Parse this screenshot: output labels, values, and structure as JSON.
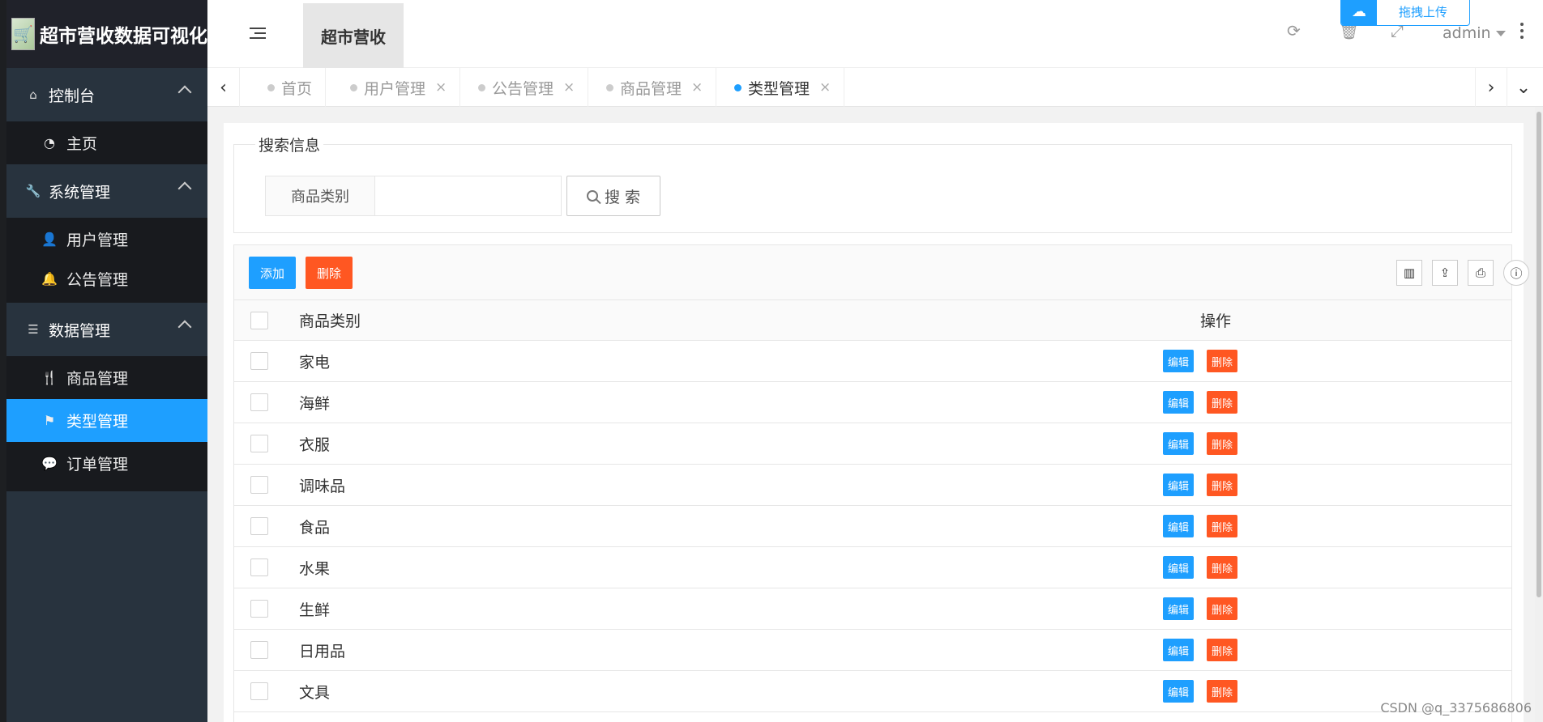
{
  "sidebar": {
    "logo_text": "超市营收数据可视化",
    "groups": [
      {
        "label": "控制台",
        "icon": "home-icon",
        "items": [
          {
            "label": "主页",
            "icon": "dashboard-icon"
          }
        ]
      },
      {
        "label": "系统管理",
        "icon": "wrench-icon",
        "items": [
          {
            "label": "用户管理",
            "icon": "user-icon"
          },
          {
            "label": "公告管理",
            "icon": "bell-icon"
          }
        ]
      },
      {
        "label": "数据管理",
        "icon": "server-icon",
        "items": [
          {
            "label": "商品管理",
            "icon": "cutlery-icon"
          },
          {
            "label": "类型管理",
            "icon": "flag-icon"
          },
          {
            "label": "订单管理",
            "icon": "chat-icon"
          }
        ]
      }
    ]
  },
  "header": {
    "title": "超市营收",
    "upload_label": "拖拽上传",
    "user": "admin"
  },
  "tabs": [
    {
      "label": "首页"
    },
    {
      "label": "用户管理"
    },
    {
      "label": "公告管理"
    },
    {
      "label": "商品管理"
    },
    {
      "label": "类型管理"
    }
  ],
  "search": {
    "legend": "搜索信息",
    "field_label": "商品类别",
    "button_label": "搜 索"
  },
  "toolbar": {
    "add_label": "添加",
    "delete_label": "删除"
  },
  "table": {
    "columns": [
      "商品类别",
      "操作"
    ],
    "edit_label": "编辑",
    "delete_label": "删除",
    "rows": [
      "家电",
      "海鲜",
      "衣服",
      "调味品",
      "食品",
      "水果",
      "生鲜",
      "日用品",
      "文具"
    ]
  },
  "watermark": "CSDN @q_3375686806",
  "colors": {
    "accent": "#1e9fff",
    "danger": "#ff5722",
    "sidebar": "#28333e"
  }
}
